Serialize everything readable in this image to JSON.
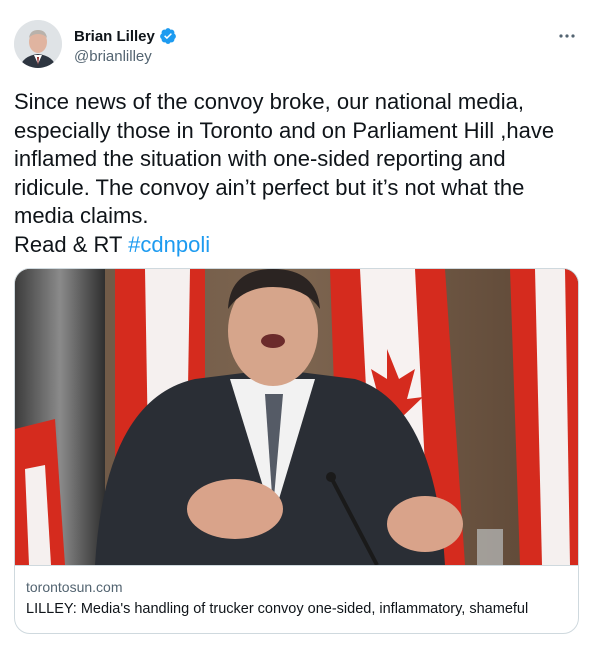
{
  "tweet": {
    "author_name": "Brian Lilley",
    "author_handle": "@brianlilley",
    "more_icon": "more-horizontal-icon",
    "verified_icon": "verified-badge-icon",
    "text_main": "Since news of the convoy broke, our national media, especially those in Toronto and on Parliament Hill ,have inflamed the situation with one-sided reporting and ridicule. The convoy ain’t perfect but it’s not what the media claims.\nRead & RT ",
    "hashtag": "#cdnpoli"
  },
  "card": {
    "domain": "torontosun.com",
    "title": "LILLEY: Media's handling of trucker convoy one-sided, inflammatory, shameful"
  },
  "colors": {
    "accent": "#1d9bf0",
    "text": "#0f1419",
    "muted": "#536471",
    "border": "#cfd9de"
  }
}
